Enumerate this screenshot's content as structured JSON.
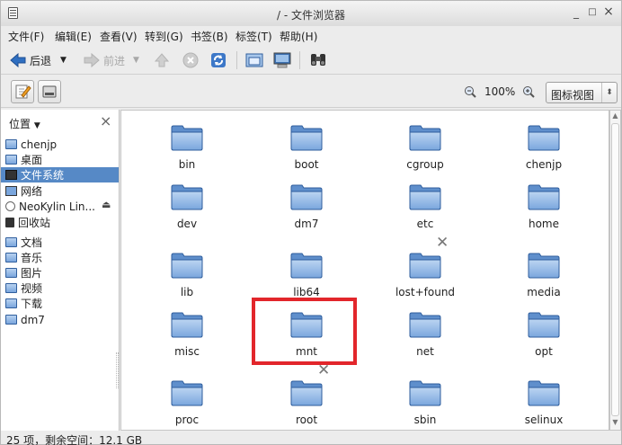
{
  "window": {
    "title": "/ - 文件浏览器",
    "minimize": "_",
    "maximize": "□",
    "close": "×"
  },
  "menu": [
    "文件(F)",
    "编辑(E)",
    "查看(V)",
    "转到(G)",
    "书签(B)",
    "标签(T)",
    "帮助(H)"
  ],
  "toolbar": {
    "back": "后退",
    "forward": "前进"
  },
  "location": {
    "zoom": "100%",
    "view_mode": "图标视图"
  },
  "sidebar": {
    "header": "位置",
    "items": [
      "chenjp",
      "桌面",
      "文件系统",
      "网络",
      "NeoKylin Lin...",
      "回收站",
      "文档",
      "音乐",
      "图片",
      "视频",
      "下载",
      "dm7"
    ],
    "selected": "文件系统"
  },
  "folders": [
    "bin",
    "boot",
    "cgroup",
    "chenjp",
    "dev",
    "dm7",
    "etc",
    "home",
    "lib",
    "lib64",
    "lost+found",
    "media",
    "misc",
    "mnt",
    "net",
    "opt",
    "proc",
    "root",
    "sbin",
    "selinux"
  ],
  "status": "25 项，剩余空间：12.1 GB",
  "colors": {
    "selection": "#5689c6",
    "highlight_box": "#e2262b",
    "folder": "#7aa6dd"
  }
}
